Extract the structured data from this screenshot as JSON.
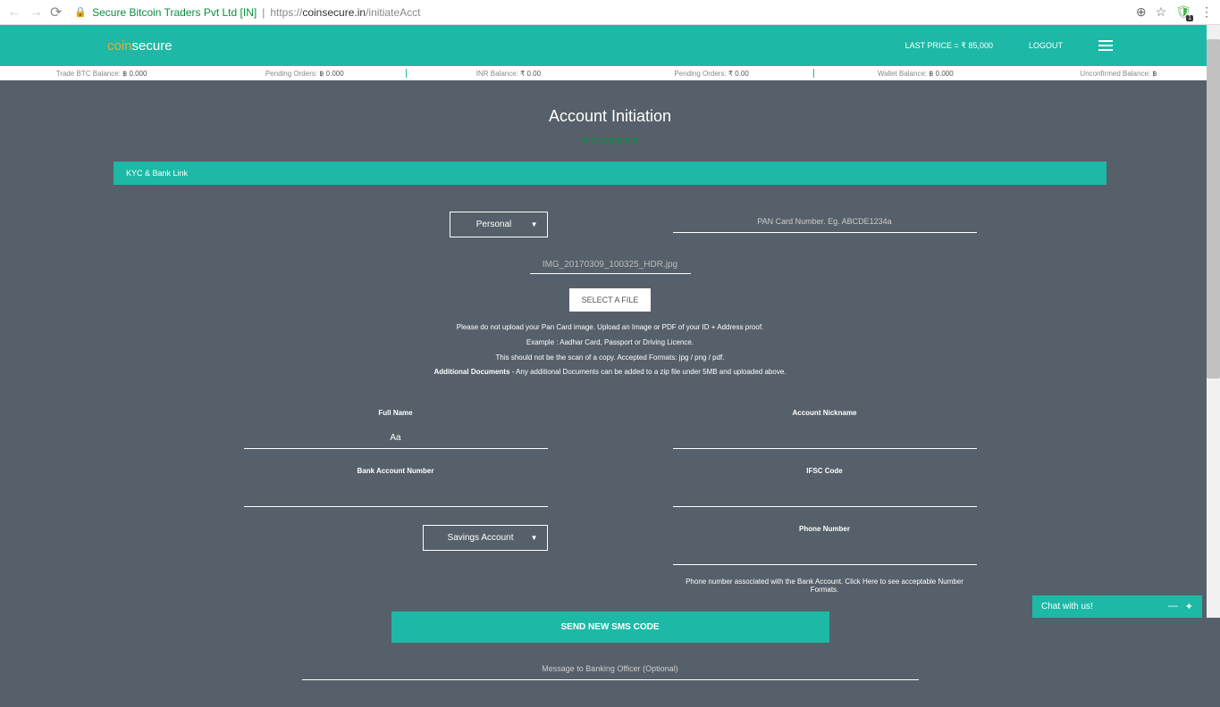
{
  "browser": {
    "cert_name": "Secure Bitcoin Traders Pvt Ltd [IN]",
    "url_prefix": "https://",
    "url_domain": "coinsecure.in",
    "url_path": "/initiateAcct",
    "shield_badge": "1"
  },
  "header": {
    "logo_prefix": "coin",
    "logo_suffix": "secure",
    "last_price": "LAST PRICE = ₹ 85,000",
    "logout": "LOGOUT"
  },
  "balances": {
    "trade_btc_label": "Trade BTC Balance:",
    "trade_btc_val": "฿ 0.000",
    "pending_btc_label": "Pending Orders:",
    "pending_btc_val": "฿ 0.000",
    "inr_label": "INR Balance:",
    "inr_val": "₹ 0.00",
    "pending_inr_label": "Pending Orders:",
    "pending_inr_val": "₹ 0.00",
    "wallet_label": "Wallet Balance:",
    "wallet_val": "฿ 0.000",
    "unconfirmed_label": "Unconfirmed Balance:",
    "unconfirmed_val": "฿"
  },
  "page": {
    "title": "Account Initiation",
    "status": "Incomplete",
    "panel_header": "KYC & Bank Link"
  },
  "form": {
    "account_type": "Personal",
    "pan_placeholder": "PAN Card Number. Eg. ABCDE1234a",
    "file_name": "IMG_20170309_100325_HDR.jpg",
    "select_file": "SELECT A FILE",
    "hint1": "Please do not upload your Pan Card image. Upload an Image or PDF of your ID + Address proof.",
    "hint2": "Example : Aadhar Card, Passport or Driving Licence.",
    "hint3": "This should not be the scan of a copy. Accepted Formats: jpg / png / pdf.",
    "hint4a": "Additional Documents",
    "hint4b": " - Any additional Documents can be added to a zip file under 5MB and uploaded above.",
    "full_name_label": "Full Name",
    "full_name_value": "Aa",
    "nickname_label": "Account Nickname",
    "bank_num_label": "Bank Account Number",
    "ifsc_label": "IFSC Code",
    "bank_type": "Savings Account",
    "phone_label": "Phone Number",
    "phone_hint": "Phone number associated with the Bank Account. Click Here to see acceptable Number Formats.",
    "sms_btn": "SEND NEW SMS CODE",
    "msg_placeholder": "Message to Banking Officer (Optional)"
  },
  "chat": {
    "label": "Chat with us!"
  }
}
